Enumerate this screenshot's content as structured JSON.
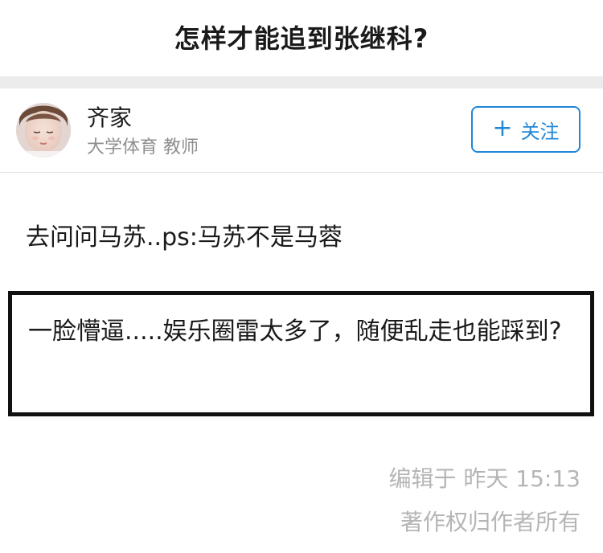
{
  "question": {
    "title": "怎样才能追到张继科?"
  },
  "author": {
    "name": "齐家",
    "description": "大学体育 教师",
    "avatar_icon": "child-portrait-avatar",
    "follow_icon": "+",
    "follow_label": "关注",
    "accent_color": "#1f87d8"
  },
  "answer": {
    "text": "去问问马苏..ps:马苏不是马蓉",
    "highlight_text": "一脸懵逼.....娱乐圈雷太多了，随便乱走也能踩到?"
  },
  "footer": {
    "edit_meta": "编辑于 昨天 15:13",
    "copyright": "著作权归作者所有"
  }
}
